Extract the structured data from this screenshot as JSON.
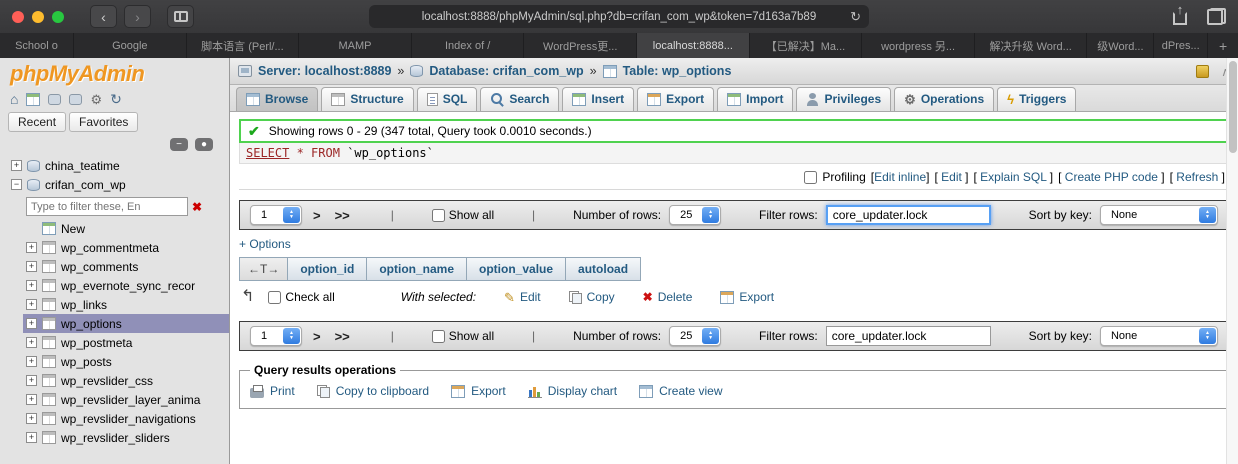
{
  "icons": {
    "back": "‹",
    "forward": "›",
    "reload": "↻",
    "share_arrow": "↑",
    "home": "⌂",
    "refresh": "↻",
    "gear": "⚙",
    "bolt": "ϟ",
    "check": "✔",
    "x": "✖",
    "pencil": "✎",
    "plus": "+",
    "minus": "−",
    "collapse_minus": "−",
    "dot": "●",
    "caret_up": "▲",
    "caret_down": "▼",
    "up_chevron": "∧",
    "with_selected_arrow": "↰"
  },
  "browser": {
    "url": "localhost:8888/phpMyAdmin/sql.php?db=crifan_com_wp&token=7d163a7b89",
    "tabs": [
      "School o",
      "Google",
      "脚本语言 (Perl/...",
      "MAMP",
      "Index of /",
      "WordPress更...",
      "localhost:8888...",
      "【已解决】Ma...",
      "wordpress 另...",
      "解决升级 Word...",
      "级Word...",
      "dPres..."
    ],
    "active_tab": "localhost:8888...",
    "new_tab_label": "+"
  },
  "sidebar": {
    "logo": "phpMyAdmin",
    "panel_tabs": [
      "Recent",
      "Favorites"
    ],
    "databases": [
      "china_teatime",
      "crifan_com_wp"
    ],
    "filter_placeholder": "Type to filter these, En",
    "tables": [
      "New",
      "wp_commentmeta",
      "wp_comments",
      "wp_evernote_sync_recor",
      "wp_links",
      "wp_options",
      "wp_postmeta",
      "wp_posts",
      "wp_revslider_css",
      "wp_revslider_layer_anima",
      "wp_revslider_navigations",
      "wp_revslider_sliders"
    ],
    "selected_table": "wp_options"
  },
  "breadcrumb": {
    "server_label": "Server:",
    "server_value": "localhost:8889",
    "separator": "»",
    "database_label": "Database:",
    "database_value": "crifan_com_wp",
    "table_label": "Table:",
    "table_value": "wp_options"
  },
  "tabs": [
    "Browse",
    "Structure",
    "SQL",
    "Search",
    "Insert",
    "Export",
    "Import",
    "Privileges",
    "Operations",
    "Triggers"
  ],
  "active_tab": "Browse",
  "result": {
    "message": "Showing rows 0 - 29 (347 total, Query took 0.0010 seconds.)",
    "sql_select": "SELECT",
    "sql_star_from": "* FROM",
    "sql_table": "`wp_options`",
    "profiling_label": "Profiling",
    "profiling_links": [
      "Edit inline",
      "Edit",
      "Explain SQL",
      "Create PHP code",
      "Refresh"
    ]
  },
  "pagination": {
    "page_value": "1",
    "next": ">",
    "last": ">>",
    "show_all": "Show all",
    "rows_label": "Number of rows:",
    "rows_value": "25",
    "filter_label": "Filter rows:",
    "filter_value": "core_updater.lock",
    "sort_label": "Sort by key:",
    "sort_value": "None"
  },
  "options_toggle": "+ Options",
  "results_table": {
    "sort_arrows": "←T→",
    "headers": [
      "option_id",
      "option_name",
      "option_value",
      "autoload"
    ]
  },
  "with_selected": {
    "check_all": "Check all",
    "label": "With selected:",
    "actions": [
      "Edit",
      "Copy",
      "Delete",
      "Export"
    ]
  },
  "query_ops": {
    "legend": "Query results operations",
    "actions": [
      "Print",
      "Copy to clipboard",
      "Export",
      "Display chart",
      "Create view"
    ]
  }
}
